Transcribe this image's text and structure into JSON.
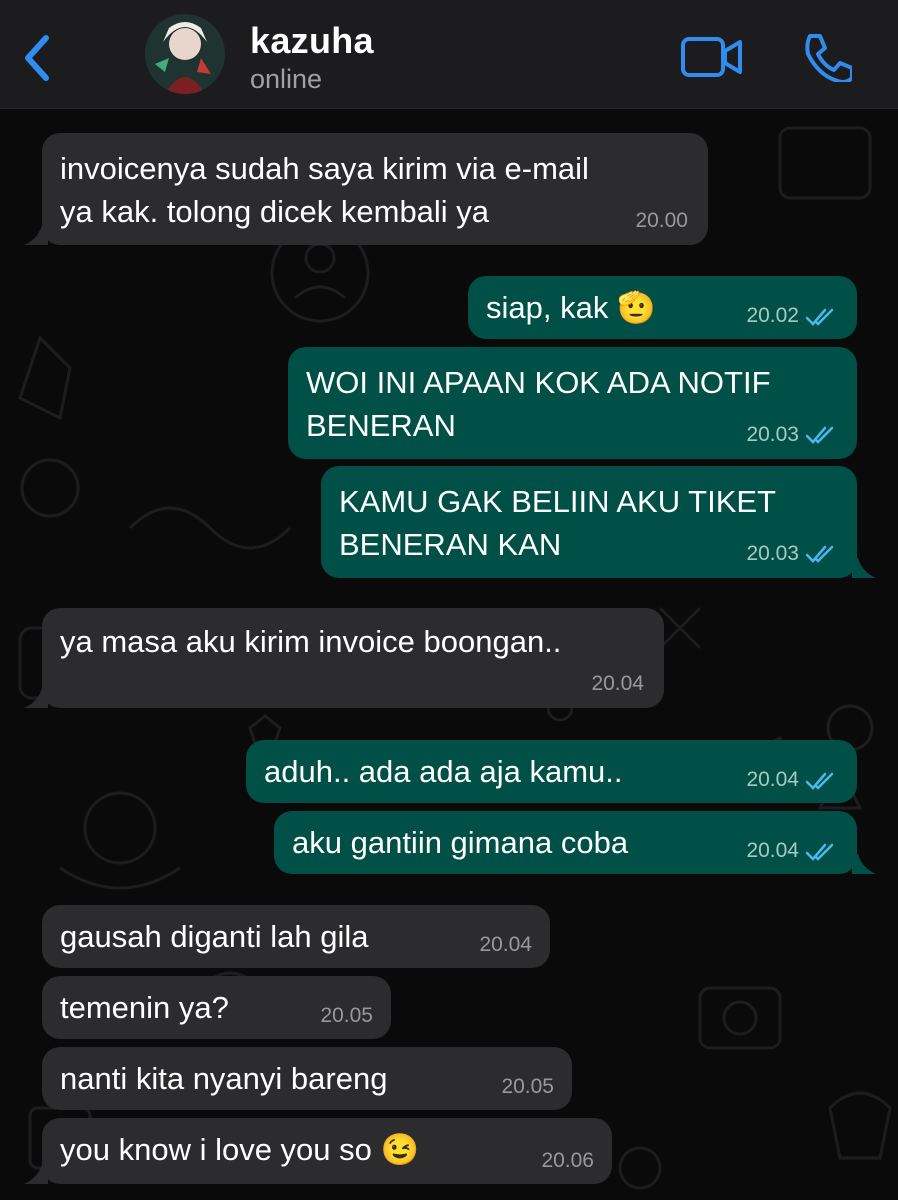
{
  "header": {
    "contact_name": "kazuha",
    "status": "online",
    "back_icon": "chevron-left-icon",
    "video_icon": "video-camera-icon",
    "call_icon": "phone-icon",
    "accent_color": "#2f8cf0"
  },
  "colors": {
    "incoming_bubble": "#2c2c2e",
    "outgoing_bubble": "#005047",
    "read_tick": "#4fb6ec"
  },
  "messages": [
    {
      "direction": "incoming",
      "lines": [
        "invoicenya sudah saya kirim via e-mail",
        "ya kak. tolong dicek kembali ya"
      ],
      "time": "20.00"
    },
    {
      "direction": "outgoing",
      "lines": [
        "siap, kak 🫡"
      ],
      "time": "20.02",
      "status": "read"
    },
    {
      "direction": "outgoing",
      "lines": [
        "WOI INI APAAN KOK ADA NOTIF",
        "BENERAN"
      ],
      "time": "20.03",
      "status": "read"
    },
    {
      "direction": "outgoing",
      "lines": [
        "KAMU GAK BELIIN AKU TIKET",
        "BENERAN KAN"
      ],
      "time": "20.03",
      "status": "read"
    },
    {
      "direction": "incoming",
      "lines": [
        "ya masa aku kirim invoice boongan.."
      ],
      "time": "20.04"
    },
    {
      "direction": "outgoing",
      "lines": [
        "aduh..  ada ada aja kamu.."
      ],
      "time": "20.04",
      "status": "read"
    },
    {
      "direction": "outgoing",
      "lines": [
        "aku gantiin gimana coba"
      ],
      "time": "20.04",
      "status": "read"
    },
    {
      "direction": "incoming",
      "lines": [
        "gausah diganti lah gila"
      ],
      "time": "20.04"
    },
    {
      "direction": "incoming",
      "lines": [
        "temenin ya?"
      ],
      "time": "20.05"
    },
    {
      "direction": "incoming",
      "lines": [
        "nanti kita nyanyi bareng"
      ],
      "time": "20.05"
    },
    {
      "direction": "incoming",
      "lines": [
        "you know i love you so 😉"
      ],
      "time": "20.06"
    }
  ]
}
